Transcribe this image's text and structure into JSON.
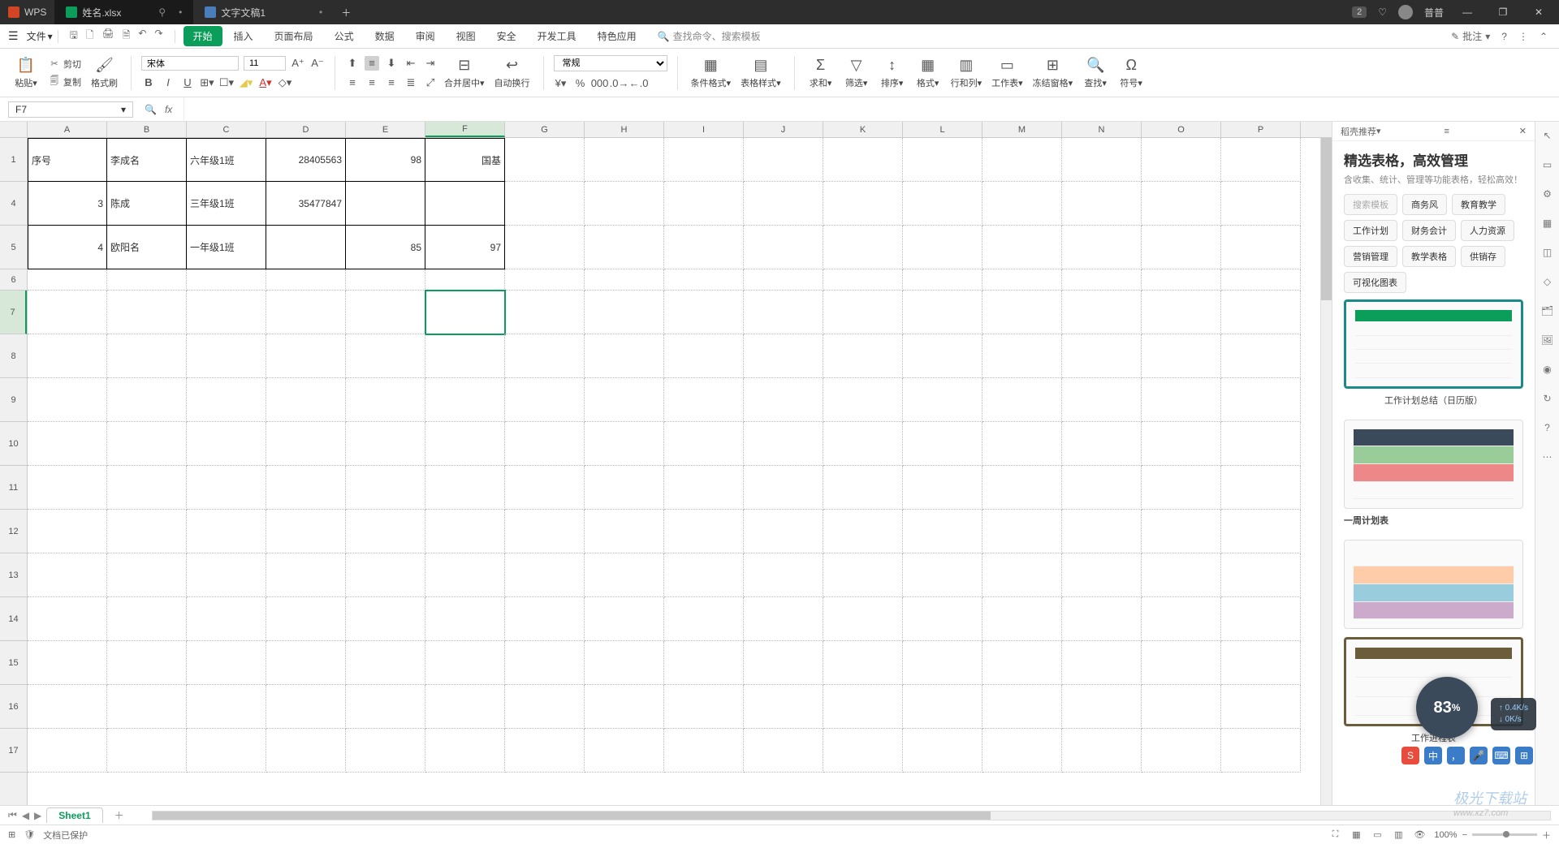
{
  "app": {
    "name": "WPS"
  },
  "titlebar": {
    "tabs": [
      {
        "label": "姓名.xlsx",
        "icon": "green"
      },
      {
        "label": "文字文稿1",
        "icon": "blue"
      }
    ],
    "notif_count": "2",
    "username": "普普"
  },
  "menu": {
    "file": "文件",
    "tabs": [
      "开始",
      "插入",
      "页面布局",
      "公式",
      "数据",
      "审阅",
      "视图",
      "安全",
      "开发工具",
      "特色应用"
    ],
    "search_placeholder": "查找命令、搜索模板",
    "approve": "批注"
  },
  "ribbon": {
    "paste": "粘贴",
    "cut": "剪切",
    "copy": "复制",
    "format_painter": "格式刷",
    "font_name": "宋体",
    "font_size": "11",
    "merge_center": "合并居中",
    "wrap": "自动换行",
    "number_format": "常规",
    "cond_fmt": "条件格式",
    "table_style": "表格样式",
    "sum": "求和",
    "filter": "筛选",
    "sort": "排序",
    "format": "格式",
    "row_col": "行和列",
    "sheet": "工作表",
    "freeze": "冻结窗格",
    "find": "查找",
    "symbol": "符号"
  },
  "namebox": {
    "ref": "F7"
  },
  "columns": [
    "A",
    "B",
    "C",
    "D",
    "E",
    "F",
    "G",
    "H",
    "I",
    "J",
    "K",
    "L",
    "M",
    "N",
    "O",
    "P"
  ],
  "rows": [
    "1",
    "4",
    "5",
    "6",
    "7",
    "8",
    "9",
    "10",
    "11",
    "12",
    "13",
    "14",
    "15",
    "16",
    "17"
  ],
  "sel": {
    "col": "F",
    "row_idx": 4
  },
  "table": {
    "r1": {
      "a": "序号",
      "b": "李成名",
      "c": "六年级1班",
      "d": "28405563",
      "e": "98",
      "f": "国基"
    },
    "r4": {
      "a": "3",
      "b": "陈成",
      "c": "三年级1班",
      "d": "35477847",
      "e": "",
      "f": ""
    },
    "r5": {
      "a": "4",
      "b": "欧阳名",
      "c": "一年级1班",
      "d": "",
      "e": "85",
      "f": "97"
    }
  },
  "sheets": {
    "active": "Sheet1"
  },
  "status": {
    "protected": "文档已保护",
    "zoom": "100%"
  },
  "panel": {
    "header": "稻壳推荐",
    "title": "精选表格，高效管理",
    "subtitle": "含收集、统计、管理等功能表格，轻松高效！",
    "chips": [
      "搜索模板",
      "商务风",
      "教育教学",
      "工作计划",
      "财务会计",
      "人力资源",
      "营销管理",
      "教学表格",
      "供销存",
      "可视化图表"
    ],
    "tpl1": "工作计划总结（日历版）",
    "tpl2": "一周计划表",
    "tpl3": "工作进程表"
  },
  "float": {
    "percent": "83",
    "percent_suffix": "%",
    "up": "0.4K/s",
    "down": "0K/s",
    "watermark_main": "极光下载站",
    "watermark_sub": "www.xz7.com",
    "ime_lang": "中"
  }
}
